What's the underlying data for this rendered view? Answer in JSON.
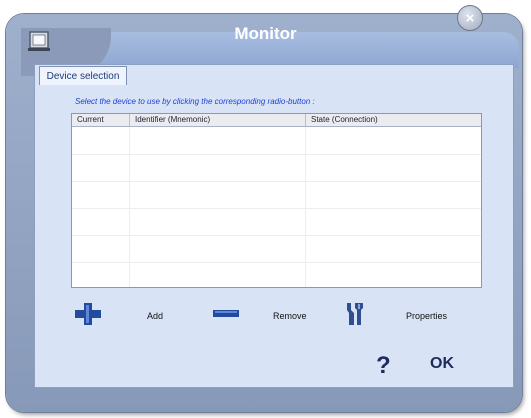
{
  "window": {
    "title": "Monitor",
    "close_icon": "close-icon",
    "app_icon": "monitor-computer-icon"
  },
  "tabs": [
    {
      "label": "Device selection",
      "selected": true
    }
  ],
  "instruction_text": "Select the device to use by clicking the corresponding radio-button :",
  "table": {
    "columns": [
      "Current",
      "Identifier (Mnemonic)",
      "State (Connection)"
    ],
    "rows": []
  },
  "actions": {
    "add_label": "Add",
    "remove_label": "Remove",
    "properties_label": "Properties",
    "add_icon": "plus-icon",
    "remove_icon": "minus-icon",
    "properties_icon": "tools-icon"
  },
  "footer": {
    "help_label": "?",
    "ok_label": "OK"
  },
  "colors": {
    "title_text": "#ffffff",
    "accent_blue": "#1d3fd8",
    "panel": "#d9e3f6"
  }
}
